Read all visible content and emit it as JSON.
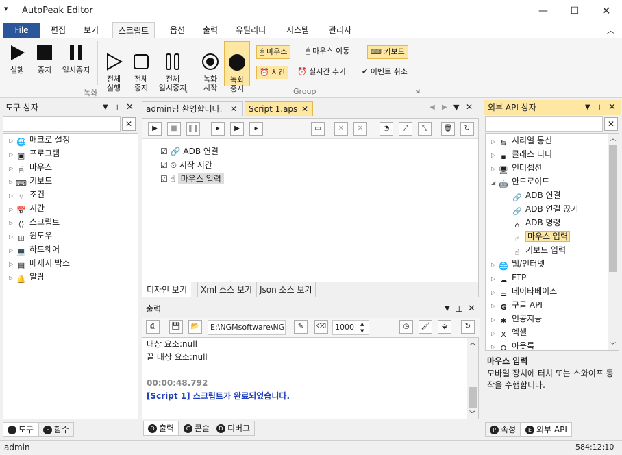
{
  "window": {
    "title": "AutoPeak Editor"
  },
  "menu": {
    "file": "File",
    "items": [
      "편집",
      "보기",
      "스크립트",
      "옵션",
      "출력",
      "유틸리티",
      "시스템",
      "관리자"
    ]
  },
  "ribbon": {
    "run": "실행",
    "stop": "중지",
    "pause": "일시중지",
    "all_run": "전체\n실행",
    "all_stop": "전체\n중지",
    "all_pause": "전체\n일시중지",
    "rec_start": "녹화\n시작",
    "rec_stop": "녹화\n중지",
    "mouse": "마우스",
    "mouse_move": "마우스 이동",
    "keyboard": "키보드",
    "time": "시간",
    "realtime_add": "실시간 추가",
    "event_cancel": "이벤트 취소",
    "group_record": "녹화",
    "group_group": "Group"
  },
  "left_panel": {
    "title": "도구 상자",
    "items": [
      "매크로 설정",
      "프로그램",
      "마우스",
      "키보드",
      "조건",
      "시간",
      "스크립트",
      "윈도우",
      "하드웨어",
      "메세지 박스",
      "알람"
    ],
    "tabs": [
      "도구",
      "함수"
    ]
  },
  "editor": {
    "tabs": [
      "admin님 환영합니다.",
      "Script 1.aps"
    ],
    "nodes": [
      "ADB 연결",
      "시작 시간",
      "마우스 입력"
    ],
    "view_tabs": [
      "디자인 보기",
      "Xml 소스 보기",
      "Json 소스 보기"
    ]
  },
  "output": {
    "title": "출력",
    "path": "E:\\NGMsoftware\\NG",
    "number": "1000",
    "lines": [
      "대상 요소:null",
      "끝 대상 요소:null",
      "",
      "00:00:48.792",
      "[Script 1] 스크립트가 완료되었습니다."
    ],
    "tabs": [
      "출력",
      "콘솔",
      "디버그"
    ]
  },
  "right_panel": {
    "title": "외부 API 상자",
    "items": [
      {
        "label": "시리얼 통신",
        "level": 0
      },
      {
        "label": "클래스 디디",
        "level": 0
      },
      {
        "label": "인터셉션",
        "level": 0
      },
      {
        "label": "안드로이드",
        "level": 0
      },
      {
        "label": "ADB 연결",
        "level": 1
      },
      {
        "label": "ADB 연결 끊기",
        "level": 1
      },
      {
        "label": "ADB 명령",
        "level": 1
      },
      {
        "label": "마우스 입력",
        "level": 1
      },
      {
        "label": "키보드 입력",
        "level": 1
      },
      {
        "label": "웹/인터넷",
        "level": 0
      },
      {
        "label": "FTP",
        "level": 0
      },
      {
        "label": "데이타베이스",
        "level": 0
      },
      {
        "label": "구글 API",
        "level": 0
      },
      {
        "label": "인공지능",
        "level": 0
      },
      {
        "label": "엑셀",
        "level": 0
      },
      {
        "label": "아웃룩",
        "level": 0
      }
    ],
    "desc_title": "마우스 입력",
    "desc_text": "모바일 장치에 터치 또는 스와이프 동작을 수행합니다.",
    "tabs": [
      "속성",
      "외부 API"
    ]
  },
  "status": {
    "user": "admin",
    "pos": "584:12:10"
  }
}
